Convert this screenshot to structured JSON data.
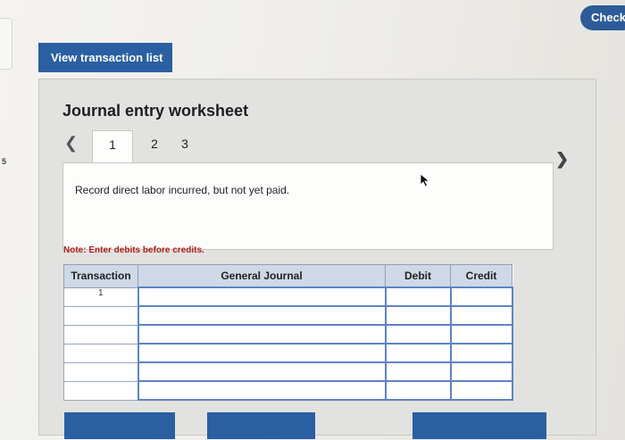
{
  "header": {
    "check_label": "Check"
  },
  "left_edge": {
    "number": "5"
  },
  "toolbar": {
    "view_transactions_label": "View transaction list"
  },
  "worksheet": {
    "title": "Journal entry worksheet",
    "tabs": [
      {
        "label": "1",
        "active": true
      },
      {
        "label": "2",
        "active": false
      },
      {
        "label": "3",
        "active": false
      }
    ],
    "prev_icon": "chevron-left-icon",
    "next_icon": "chevron-right-icon",
    "description": "Record direct labor incurred, but not yet paid.",
    "note": "Note: Enter debits before credits."
  },
  "journal_table": {
    "headers": [
      "Transaction",
      "General Journal",
      "Debit",
      "Credit"
    ],
    "rows": [
      {
        "transaction": "1",
        "account": "",
        "debit": "",
        "credit": ""
      },
      {
        "transaction": "",
        "account": "",
        "debit": "",
        "credit": ""
      },
      {
        "transaction": "",
        "account": "",
        "debit": "",
        "credit": ""
      },
      {
        "transaction": "",
        "account": "",
        "debit": "",
        "credit": ""
      },
      {
        "transaction": "",
        "account": "",
        "debit": "",
        "credit": ""
      },
      {
        "transaction": "",
        "account": "",
        "debit": "",
        "credit": ""
      }
    ]
  },
  "colors": {
    "button_blue": "#2a5fa2",
    "note_red": "#b0201a",
    "table_header": "#cfd8e6"
  }
}
